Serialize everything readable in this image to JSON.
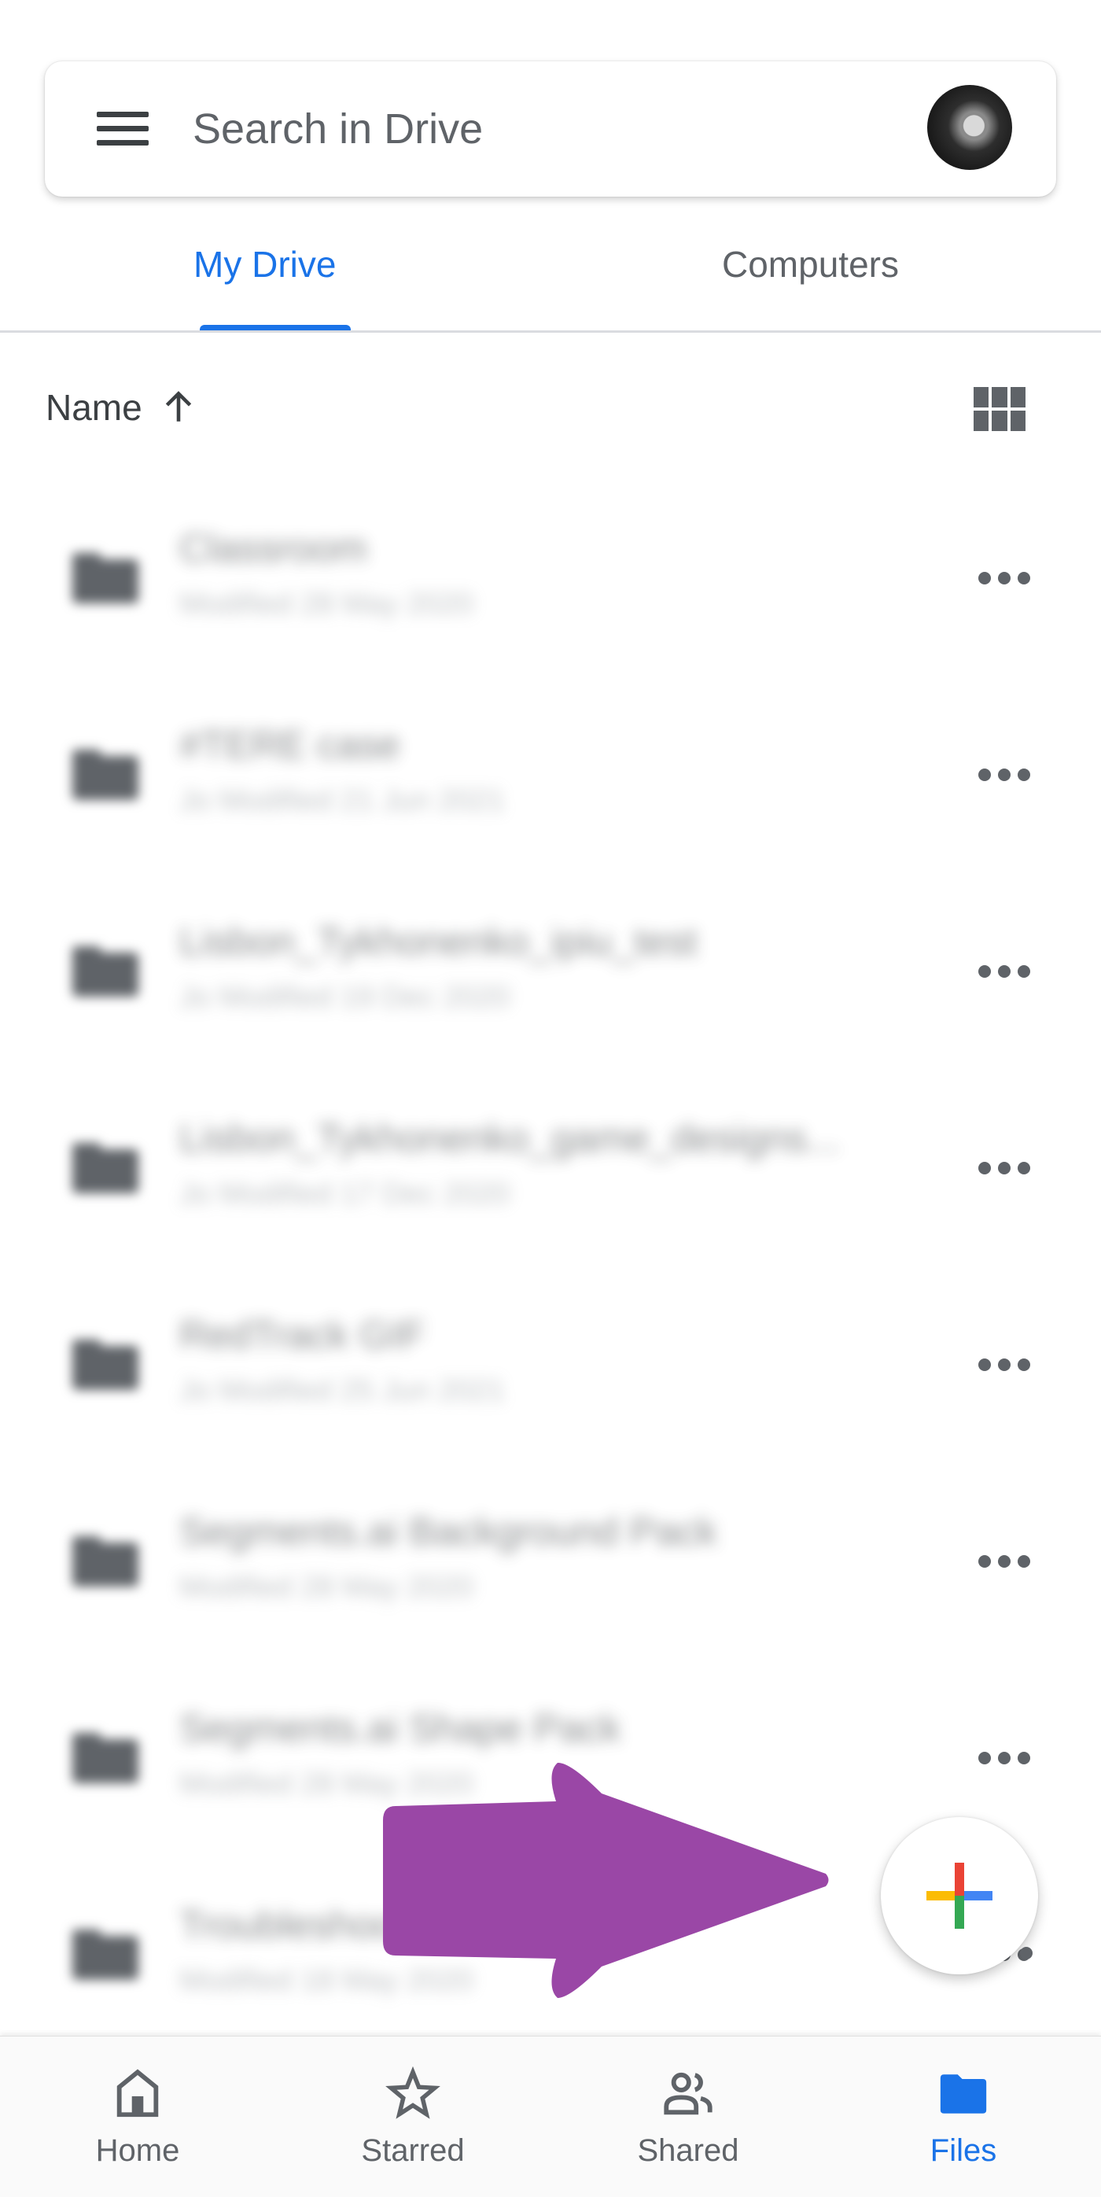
{
  "search": {
    "placeholder": "Search in Drive",
    "menu_icon": "hamburger-menu-icon",
    "avatar": "user-avatar"
  },
  "tabs": [
    {
      "label": "My Drive",
      "active": true
    },
    {
      "label": "Computers",
      "active": false
    }
  ],
  "sort": {
    "label": "Name",
    "direction_icon": "arrow-up-icon",
    "view_toggle_icon": "grid-view-icon"
  },
  "files": [
    {
      "name": "Classroom",
      "meta": "Modified 28 May 2020",
      "type": "folder"
    },
    {
      "name": "#TERE case",
      "meta": "Jo Modified 21 Jun 2021",
      "type": "folder"
    },
    {
      "name": "Lisbon_Tykhonenko_ipiu_test",
      "meta": "Jo Modified 19 Dec 2020",
      "type": "folder"
    },
    {
      "name": "Lisbon_Tykhonenko_game_designs...",
      "meta": "Jo Modified 17 Dec 2020",
      "type": "folder"
    },
    {
      "name": "RedTrack GIF",
      "meta": "Jo Modified 25 Jun 2021",
      "type": "folder"
    },
    {
      "name": "Segments.ai Background Pack",
      "meta": "Modified 28 May 2020",
      "type": "folder"
    },
    {
      "name": "Segments.ai Shape Pack",
      "meta": "Modified 28 May 2020",
      "type": "folder"
    },
    {
      "name": "Troubleshoot...",
      "meta": "Modified 18 May 2020",
      "type": "folder"
    }
  ],
  "fab": {
    "icon": "google-plus-icon",
    "colors": {
      "top": "#ea4335",
      "right": "#4285f4",
      "bottom": "#34a853",
      "left": "#fbbc04"
    }
  },
  "annotation": {
    "type": "arrow-pointing-right",
    "color": "#9a47a6"
  },
  "bottom_nav": [
    {
      "label": "Home",
      "icon": "home-icon",
      "active": false
    },
    {
      "label": "Starred",
      "icon": "star-icon",
      "active": false
    },
    {
      "label": "Shared",
      "icon": "shared-people-icon",
      "active": false
    },
    {
      "label": "Files",
      "icon": "folder-icon",
      "active": true
    }
  ],
  "colors": {
    "accent": "#1a73e8",
    "text": "#3c4043",
    "muted": "#5f6368"
  }
}
